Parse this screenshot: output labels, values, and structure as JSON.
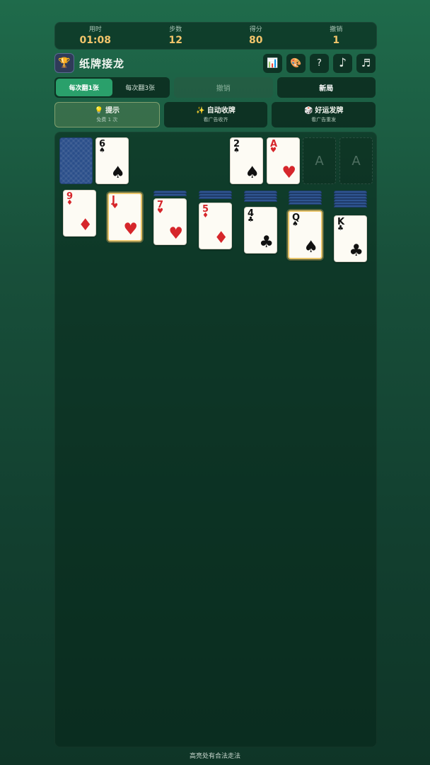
{
  "stats": [
    {
      "label": "用时",
      "value": "01:08"
    },
    {
      "label": "步数",
      "value": "12"
    },
    {
      "label": "得分",
      "value": "80"
    },
    {
      "label": "撤销",
      "value": "1"
    }
  ],
  "header": {
    "app_icon": "trophy-icon",
    "title": "纸牌接龙",
    "tools": [
      {
        "name": "stats",
        "icon": "bar-chart-icon",
        "glyph": "📊"
      },
      {
        "name": "theme",
        "icon": "palette-icon",
        "glyph": "🎨"
      },
      {
        "name": "help",
        "icon": "question-icon",
        "glyph": "?"
      },
      {
        "name": "sound",
        "icon": "music-note-icon",
        "glyph": "♪"
      },
      {
        "name": "music",
        "icon": "music-notes-icon",
        "glyph": "♬"
      }
    ]
  },
  "mode": {
    "draw1": "每次翻1张",
    "draw3": "每次翻3张",
    "selected": "draw1"
  },
  "undo_label": "撤销",
  "new_game_label": "新局",
  "actions": {
    "hint": {
      "icon": "💡",
      "title": "提示",
      "sub": "免费 1 次"
    },
    "auto": {
      "icon": "✨",
      "title": "自动收牌",
      "sub": "看广告收齐"
    },
    "lucky": {
      "icon": "🎲",
      "title": "好运发牌",
      "sub": "看广告重发"
    }
  },
  "stock": {
    "has_cards": true
  },
  "waste": {
    "rank": "6",
    "suit": "♠",
    "color": "black"
  },
  "foundations": [
    {
      "rank": "2",
      "suit": "♠",
      "color": "black"
    },
    {
      "rank": "A",
      "suit": "♥",
      "color": "red"
    },
    {
      "empty_label": "A"
    },
    {
      "empty_label": "A"
    }
  ],
  "tableau": [
    {
      "hidden": 0,
      "top": {
        "rank": "9",
        "suit": "♦",
        "color": "red"
      },
      "selected": false
    },
    {
      "hidden": 0,
      "top": {
        "rank": "J",
        "suit": "♥",
        "color": "red"
      },
      "selected": true
    },
    {
      "hidden": 2,
      "top": {
        "rank": "7",
        "suit": "♥",
        "color": "red"
      },
      "selected": false
    },
    {
      "hidden": 3,
      "top": {
        "rank": "5",
        "suit": "♦",
        "color": "red"
      },
      "selected": false
    },
    {
      "hidden": 4,
      "top": {
        "rank": "4",
        "suit": "♣",
        "color": "black"
      },
      "selected": false
    },
    {
      "hidden": 5,
      "top": {
        "rank": "Q",
        "suit": "♠",
        "color": "black"
      },
      "selected": true
    },
    {
      "hidden": 6,
      "top": {
        "rank": "K",
        "suit": "♣",
        "color": "black"
      },
      "selected": false
    }
  ],
  "colors": {
    "accent": "#2aa06b",
    "gold": "#f2c56b",
    "red_suit": "#d6262b"
  },
  "footer_tip": "高亮处有合法走法"
}
